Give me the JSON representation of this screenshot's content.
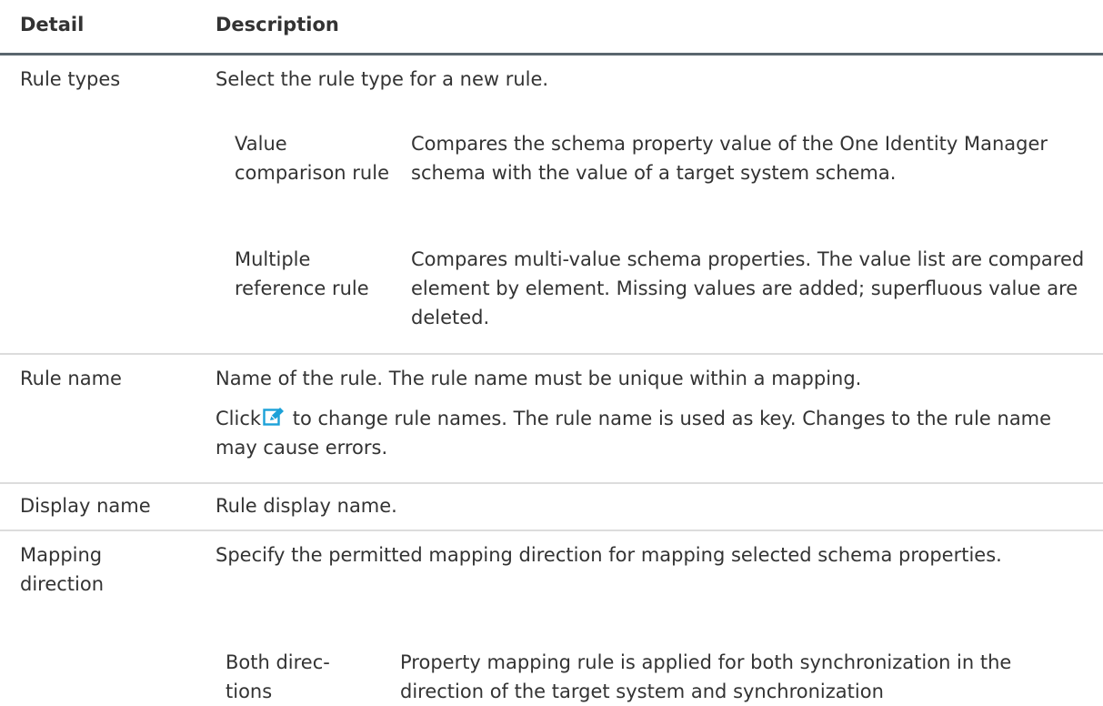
{
  "header": {
    "detail": "Detail",
    "description": "Description"
  },
  "rows": [
    {
      "detail": "Rule types",
      "description": "Select the rule type for a new rule.",
      "sub": [
        {
          "term": "Value comparison rule",
          "definition": "Compares the schema property value of the One Identity Manager schema with the value of a target system schema."
        },
        {
          "term": "Multiple reference rule",
          "definition": "Compares multi-value schema properties. The value list are compared element by element. Missing values are added; superfluous value are deleted."
        }
      ]
    },
    {
      "detail": "Rule name",
      "description": "Name of the rule. The rule name must be unique within a mapping.",
      "description2_before": "Click",
      "description2_after": " to change rule names. The rule name is used as key. Changes to the rule name may cause errors.",
      "icon": "edit-icon",
      "icon_color": "#1ba1d8"
    },
    {
      "detail": "Display name",
      "description": "Rule display name."
    },
    {
      "detail": "Mapping direction",
      "description": "Specify the permitted mapping direction for mapping selected schema properties.",
      "sub": [
        {
          "term": "Both direc- tions",
          "definition": "Property mapping rule is applied for both synchronization in the direction of the target system and synchronization"
        }
      ]
    }
  ]
}
